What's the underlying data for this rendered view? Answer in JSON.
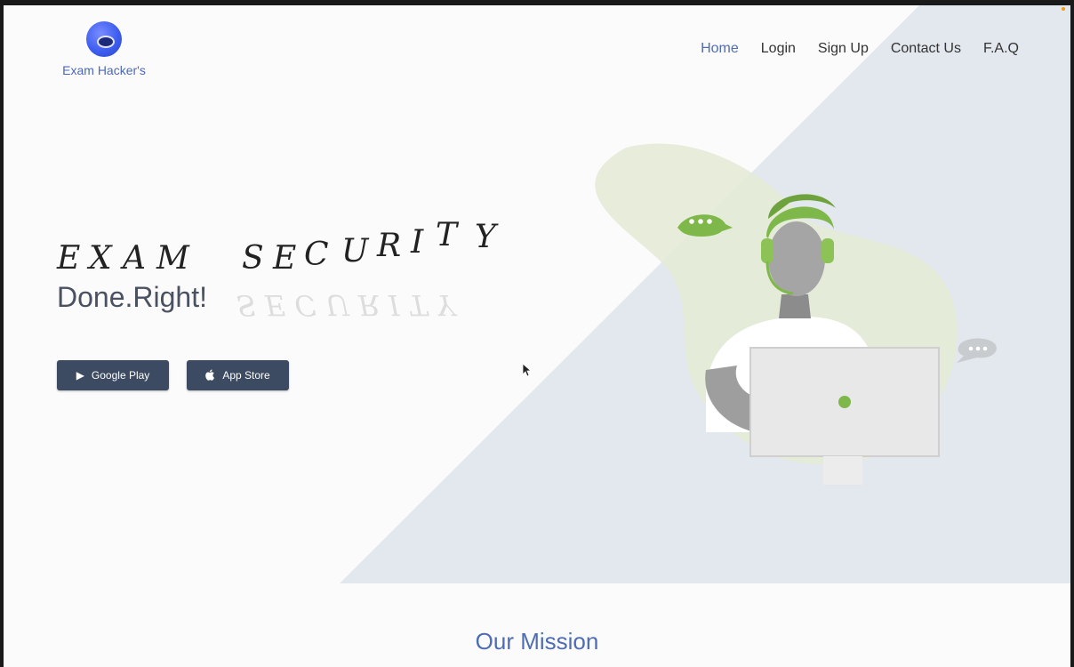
{
  "brand": {
    "name": "Exam Hacker's",
    "logo_icon": "eye-globe-icon"
  },
  "nav": {
    "items": [
      {
        "label": "Home",
        "active": true
      },
      {
        "label": "Login",
        "active": false
      },
      {
        "label": "Sign Up",
        "active": false
      },
      {
        "label": "Contact Us",
        "active": false
      },
      {
        "label": "F.A.Q",
        "active": false
      }
    ]
  },
  "hero": {
    "headline_letters": [
      "E",
      "X",
      "A",
      "M",
      "S",
      "E",
      "C",
      "U",
      "R",
      "I",
      "T",
      "Y"
    ],
    "subheadline": "Done.Right!",
    "reflection_text": "SECURITY",
    "buttons": {
      "google_play": {
        "label": "Google Play",
        "icon": "play-triangle-icon"
      },
      "app_store": {
        "label": "App Store",
        "icon": "apple-icon"
      }
    }
  },
  "mission": {
    "title": "Our Mission"
  },
  "colors": {
    "accent": "#4f6db4",
    "button_bg": "#3c4a62",
    "diagonal_bg": "#e3e7ee",
    "illustration_green": "#7fb84a",
    "blob_green": "#e4ebd6"
  }
}
